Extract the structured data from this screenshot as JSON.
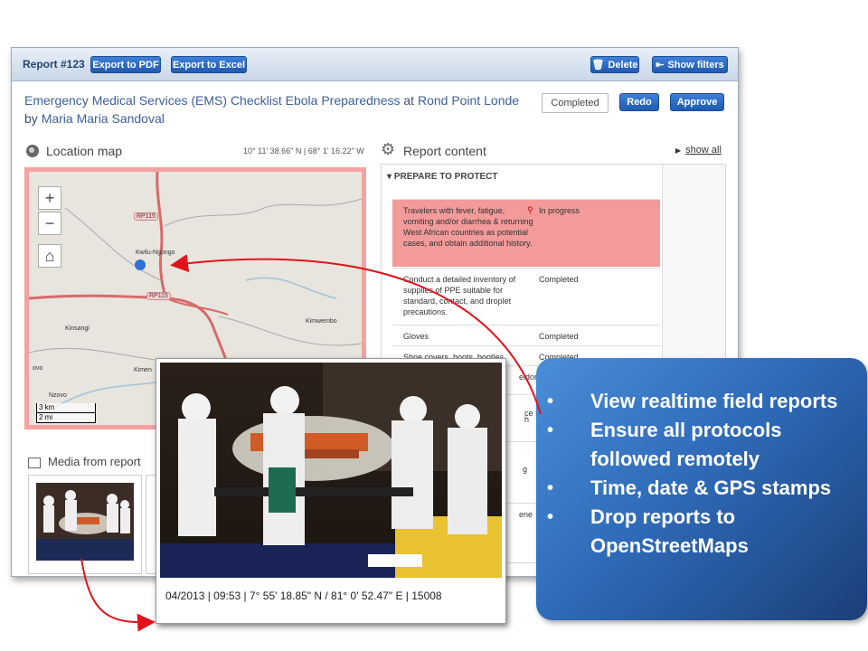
{
  "toolbar": {
    "report_id": "Report #123",
    "export_pdf": "Export to PDF",
    "export_excel": "Export to Excel",
    "delete": "Delete",
    "show_filters": "Show filters"
  },
  "header": {
    "checklist_title": "Emergency Medical Services (EMS) Checklist Ebola Preparedness",
    "at_word": "at",
    "location": "Rond Point Londe",
    "by_word": "by",
    "author": "Maria Maria Sandoval",
    "status": "Completed",
    "redo": "Redo",
    "approve": "Approve"
  },
  "location_map": {
    "title": "Location map",
    "coordinates": "10° 11' 38.66\" N | 68° 1' 16.22\" W",
    "labels": {
      "town1": "Kwilu-Ngongo",
      "town2": "Kinsangi",
      "town3": "Kimwembo",
      "town4": "Kimen",
      "town5": "Nzovo",
      "town6": "ovo",
      "road1": "RP115",
      "road2": "RP115"
    },
    "scale_km": "3 km",
    "scale_mi": "2 mi"
  },
  "report_content": {
    "title": "Report content",
    "show_all": "show all",
    "section": "PREPARE TO PROTECT",
    "rows": [
      {
        "question": "Travelers with fever, fatigue, vomiting and/or diarrhea & returning West African countries as potential cases, and obtain additional history.",
        "status": "In progress"
      },
      {
        "question": "Conduct a detailed inventory of supplies of PPE suitable for standard, contact, and droplet precautions.",
        "status": "Completed"
      },
      {
        "question": "Gloves",
        "status": "Completed"
      },
      {
        "question": "Shoe covers, boots, bootles",
        "status": "Completed"
      },
      {
        "question": "eldor",
        "status": ""
      },
      {
        "question": "ce",
        "status": ""
      },
      {
        "question": "h",
        "status": ""
      },
      {
        "question": "g",
        "status": ""
      },
      {
        "question": "ene",
        "status": ""
      }
    ]
  },
  "media": {
    "title": "Media from report"
  },
  "photo": {
    "stamp": "04/2013 | 09:53 | 7° 55' 18.85\" N / 81° 0' 52.47\" E | 15008"
  },
  "callout": {
    "items": [
      "View realtime field reports",
      "Ensure all protocols followed remotely",
      "Time, date & GPS stamps",
      "Drop reports to OpenStreetMaps"
    ]
  },
  "colors": {
    "accent_blue": "#1f5bb2",
    "highlight_red": "#f39a9a",
    "callout_start": "#4a8ed8",
    "callout_end": "#1b3f7a",
    "arrow_red": "#e0141b"
  }
}
